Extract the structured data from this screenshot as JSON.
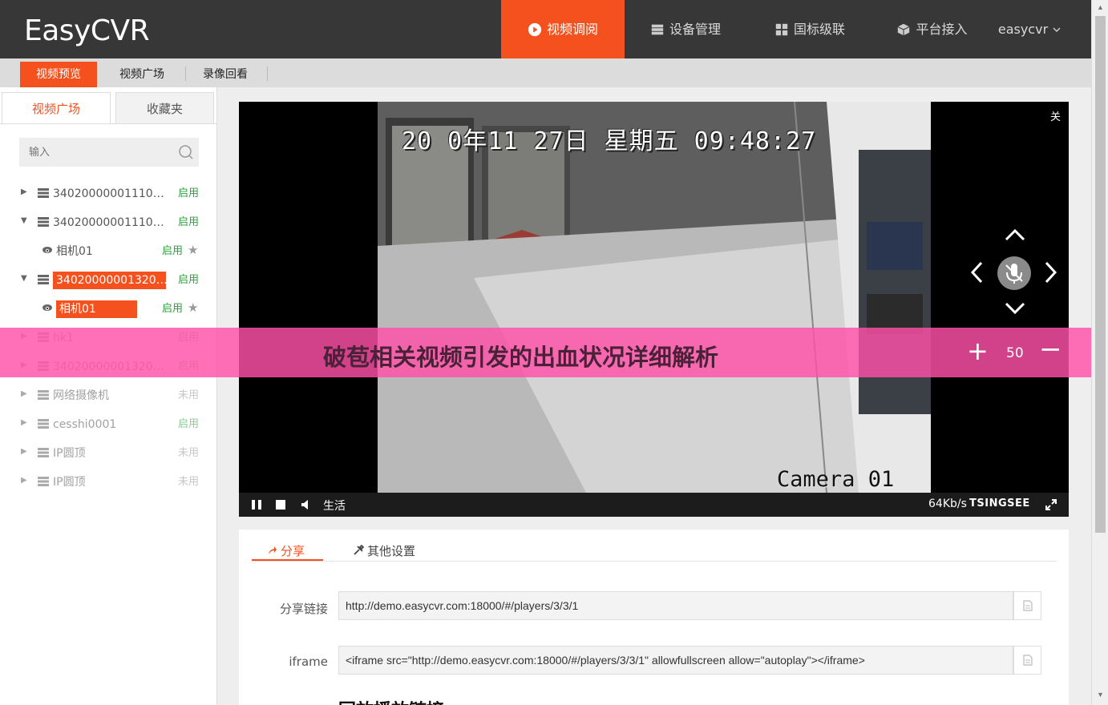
{
  "header": {
    "logo": "EasyCVR",
    "nav": [
      {
        "label": "视频调阅",
        "icon": "play-circle-icon",
        "active": true
      },
      {
        "label": "设备管理",
        "icon": "server-icon"
      },
      {
        "label": "国标级联",
        "icon": "grid-icon"
      },
      {
        "label": "平台接入",
        "icon": "cube-icon"
      }
    ],
    "user": "easycvr"
  },
  "subnav": {
    "items": [
      {
        "label": "视频预览",
        "active": true
      },
      {
        "label": "视频广场"
      },
      {
        "label": "录像回看"
      }
    ]
  },
  "sidebar": {
    "tabs": [
      {
        "label": "视频广场",
        "active": true
      },
      {
        "label": "收藏夹"
      }
    ],
    "search_placeholder": "输入",
    "tree": [
      {
        "label": "34020000001110…",
        "status": "启用",
        "expanded": false,
        "type": "device"
      },
      {
        "label": "34020000001110…",
        "status": "启用",
        "expanded": true,
        "type": "device"
      },
      {
        "label": "相机01",
        "status": "启用",
        "type": "camera"
      },
      {
        "label": "34020000001320…",
        "status": "启用",
        "expanded": true,
        "type": "device",
        "selected": true
      },
      {
        "label": "相机01",
        "status": "启用",
        "type": "camera",
        "selected": true
      },
      {
        "label": "hk1",
        "status": "启用",
        "expanded": false,
        "type": "device"
      },
      {
        "label": "34020000001320…",
        "status": "启用",
        "expanded": false,
        "type": "device"
      },
      {
        "label": "网络摄像机",
        "status": "未用",
        "expanded": false,
        "type": "device"
      },
      {
        "label": "cesshi0001",
        "status": "启用",
        "expanded": false,
        "type": "device"
      },
      {
        "label": "IP圆顶",
        "status": "未用",
        "expanded": false,
        "type": "device"
      },
      {
        "label": "IP圆顶",
        "status": "未用",
        "expanded": false,
        "type": "device"
      }
    ]
  },
  "video": {
    "osd_datetime": "20 0年11 27日 星期五 09:48:27",
    "camera_label": "Camera 01",
    "close_label": "关",
    "live_label": "生活",
    "bitrate": "64Kb/s",
    "brand": "TSINGSEE"
  },
  "banner": {
    "title": "破苞相关视频引发的出血状况详细解析",
    "zoom_plus": "+",
    "zoom_value": "50",
    "zoom_minus": "−"
  },
  "panel": {
    "tabs": [
      {
        "label": "分享",
        "icon": "share-icon",
        "active": true
      },
      {
        "label": "其他设置",
        "icon": "tools-icon"
      }
    ],
    "share_link_label": "分享链接",
    "share_link_value": "http://demo.easycvr.com:18000/#/players/3/3/1",
    "iframe_label": "iframe",
    "iframe_value": "<iframe src=\"http://demo.easycvr.com:18000/#/players/3/3/1\" allowfullscreen allow=\"autoplay\"></iframe>",
    "cutoff_heading": "回放播放链接"
  },
  "colors": {
    "accent": "#f4511e",
    "topbar": "#373737",
    "status_on": "#2e9e3e",
    "banner": "#ff50aa"
  }
}
